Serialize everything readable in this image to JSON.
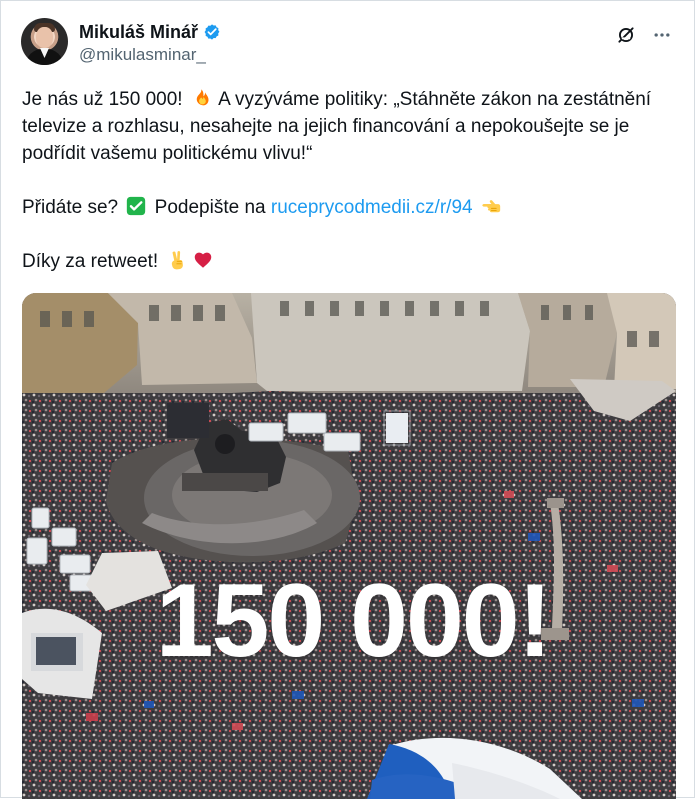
{
  "tweet": {
    "author": {
      "name": "Mikuláš Minář",
      "handle": "@mikulasminar_",
      "verified": true
    },
    "paragraphs": [
      {
        "segments": [
          {
            "type": "text",
            "value": "Je nás už 150 000! "
          },
          {
            "type": "emoji",
            "value": "fire"
          },
          {
            "type": "text",
            "value": " A vyzýváme politiky: „Stáhněte zákon na zestátnění televize a rozhlasu, nesahejte na jejich financování a nepokoušejte se je podřídit vašemu politickému vlivu!“"
          }
        ]
      },
      {
        "segments": [
          {
            "type": "text",
            "value": "Přidáte se? "
          },
          {
            "type": "emoji",
            "value": "check-mark"
          },
          {
            "type": "text",
            "value": " Podepište na "
          },
          {
            "type": "link",
            "value": "ruceprycodmedii.cz/r/94"
          },
          {
            "type": "text",
            "value": " "
          },
          {
            "type": "emoji",
            "value": "pointing-left"
          }
        ]
      },
      {
        "segments": [
          {
            "type": "text",
            "value": "Díky za retweet! "
          },
          {
            "type": "emoji",
            "value": "victory-hand"
          },
          {
            "type": "emoji",
            "value": "red-heart"
          }
        ]
      }
    ],
    "media": {
      "overlay_text": "150 000!",
      "description_icon": "crowd-photo"
    },
    "actions": {
      "share_icon": "grok-icon",
      "more_icon": "more-icon"
    }
  },
  "colors": {
    "text": "#0f1419",
    "secondary": "#536471",
    "link": "#1d9bf0",
    "verified": "#1d9bf0",
    "heart": "#e0245e",
    "check": "#21b44b"
  }
}
